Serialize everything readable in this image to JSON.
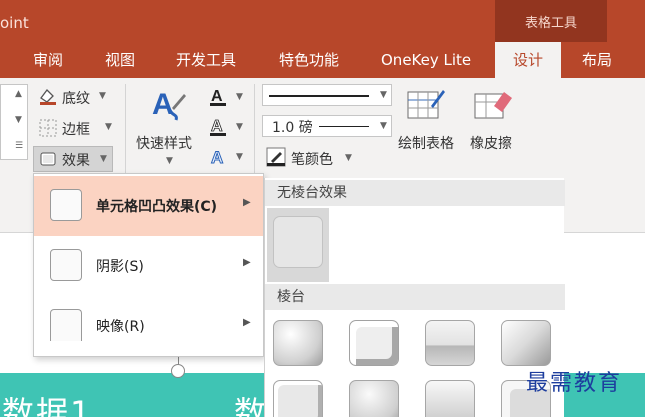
{
  "window": {
    "app_name": "oint"
  },
  "context_header": "表格工具",
  "tabs": [
    {
      "label": "审阅"
    },
    {
      "label": "视图"
    },
    {
      "label": "开发工具"
    },
    {
      "label": "特色功能"
    },
    {
      "label": "OneKey Lite"
    },
    {
      "label": "设计"
    },
    {
      "label": "布局"
    }
  ],
  "ribbon": {
    "shading_label": "底纹",
    "borders_label": "边框",
    "effects_label": "效果",
    "quick_styles_label": "快速样式",
    "pen_weight_value": "1.0 磅",
    "pen_color_label": "笔颜色",
    "draw_table_label": "绘制表格",
    "eraser_label": "橡皮擦"
  },
  "effects_menu": {
    "items": [
      {
        "label": "单元格凹凸效果(C)",
        "highlighted": true
      },
      {
        "label": "阴影(S)"
      },
      {
        "label": "映像(R)"
      }
    ]
  },
  "bevel_gallery": {
    "no_bevel_header": "无棱台效果",
    "bevel_header": "棱台"
  },
  "slide": {
    "cell_text": "数据1",
    "cell_text_2": "数"
  },
  "watermark": "最需教育",
  "colors": {
    "accent": "#b7472a",
    "context": "#92351f",
    "table": "#3fc4b4",
    "highlight": "#fbd3c2"
  }
}
